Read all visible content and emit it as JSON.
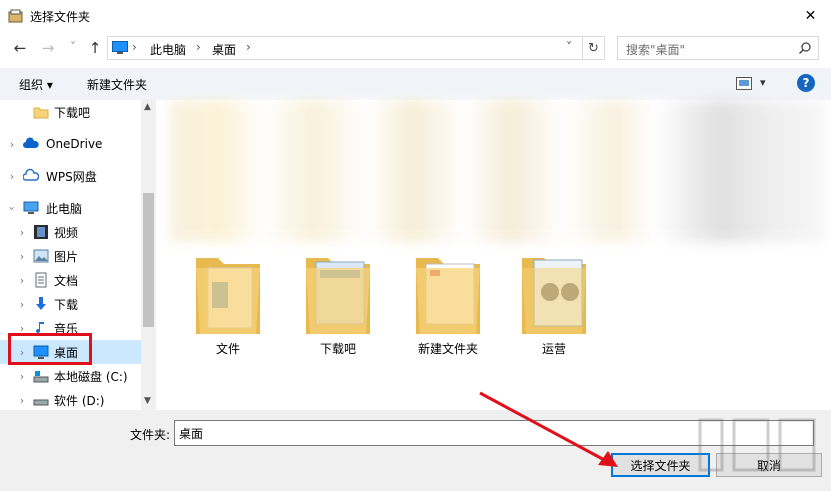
{
  "window": {
    "title": "选择文件夹",
    "close_glyph": "✕"
  },
  "nav": {
    "back_glyph": "←",
    "forward_glyph": "→",
    "recent_glyph": "˅",
    "up_glyph": "↑",
    "breadcrumb": [
      "此电脑",
      "桌面"
    ],
    "sep_glyph": "›",
    "dropdown_glyph": "˅",
    "refresh_glyph": "↻"
  },
  "search": {
    "placeholder": "搜索\"桌面\""
  },
  "toolbar": {
    "organize_label": "组织 ▾",
    "new_folder_label": "新建文件夹",
    "view_glyph": "▾",
    "help_glyph": "?"
  },
  "sidebar": {
    "items": [
      {
        "label": "下载吧",
        "icon": "folder-icon",
        "indent": 1
      },
      {
        "label": "OneDrive",
        "icon": "cloud-icon",
        "indent": 0
      },
      {
        "label": "WPS网盘",
        "icon": "cloud-icon",
        "indent": 0
      },
      {
        "label": "此电脑",
        "icon": "computer-icon",
        "indent": 0
      },
      {
        "label": "视频",
        "icon": "video-icon",
        "indent": 1
      },
      {
        "label": "图片",
        "icon": "pictures-icon",
        "indent": 1
      },
      {
        "label": "文档",
        "icon": "documents-icon",
        "indent": 1
      },
      {
        "label": "下载",
        "icon": "download-icon",
        "indent": 1
      },
      {
        "label": "音乐",
        "icon": "music-icon",
        "indent": 1
      },
      {
        "label": "桌面",
        "icon": "desktop-icon",
        "indent": 1
      },
      {
        "label": "本地磁盘 (C:)",
        "icon": "drive-icon",
        "indent": 1
      },
      {
        "label": "软件 (D:)",
        "icon": "drive-icon",
        "indent": 1
      }
    ]
  },
  "content": {
    "folders": [
      {
        "name": "文件"
      },
      {
        "name": "下载吧"
      },
      {
        "name": "新建文件夹"
      },
      {
        "name": "运营"
      }
    ]
  },
  "footer": {
    "folder_label": "文件夹:",
    "folder_value": "桌面",
    "select_label": "选择文件夹",
    "cancel_label": "取消"
  },
  "colors": {
    "accent": "#0078d7",
    "highlight": "#e0101a",
    "selected_bg": "#cce8ff",
    "folder": "#f6d27a"
  }
}
